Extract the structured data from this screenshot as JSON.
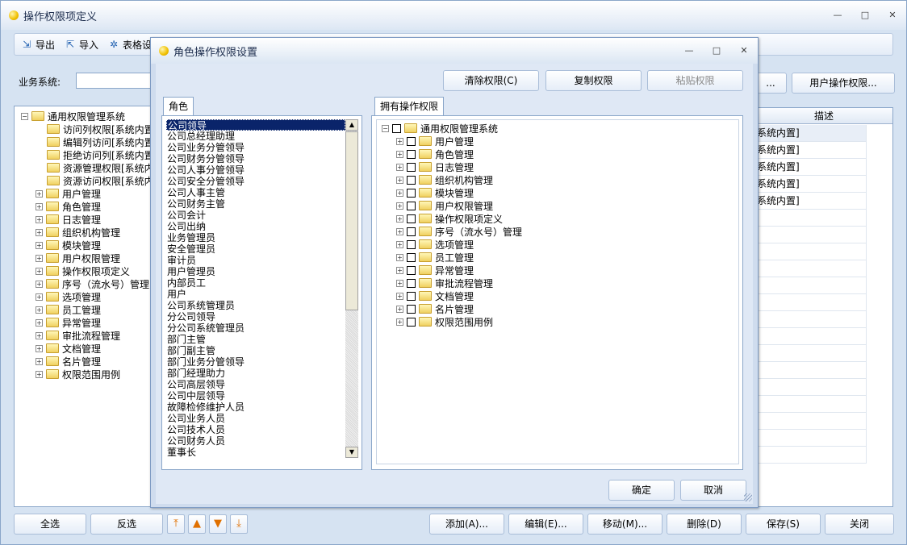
{
  "window": {
    "title": "操作权限项定义",
    "min": "—",
    "max": "□",
    "close": "✕"
  },
  "toolbar": {
    "export": "导出",
    "import": "导入",
    "table_settings": "表格设"
  },
  "business": {
    "label": "业务系统:",
    "value": ""
  },
  "left_tree": {
    "root": "通用权限管理系统",
    "leaves": [
      "访问列权限[系统内置]",
      "编辑列访问[系统内置]",
      "拒绝访问列[系统内置]",
      "资源管理权限[系统内置]",
      "资源访问权限[系统内置]"
    ],
    "nodes": [
      "用户管理",
      "角色管理",
      "日志管理",
      "组织机构管理",
      "模块管理",
      "用户权限管理",
      "操作权限项定义",
      "序号（流水号）管理",
      "选项管理",
      "员工管理",
      "异常管理",
      "审批流程管理",
      "文档管理",
      "名片管理",
      "权限范围用例"
    ]
  },
  "right_grid": {
    "header": "描述",
    "cells": [
      "系统内置]",
      "系统内置]",
      "系统内置]",
      "系统内置]",
      "系统内置]"
    ]
  },
  "main_buttons": {
    "ellipsis": "...",
    "user_perm": "用户操作权限..."
  },
  "bottom": {
    "select_all": "全选",
    "invert": "反选",
    "add": "添加(A)...",
    "edit": "编辑(E)...",
    "move": "移动(M)...",
    "delete": "删除(D)",
    "save": "保存(S)",
    "close": "关闭"
  },
  "arrows": {
    "top": "⤒",
    "up": "▲",
    "down": "▼",
    "bottom": "⤓"
  },
  "dialog": {
    "title": "角色操作权限设置",
    "clear": "清除权限(C)",
    "copy": "复制权限",
    "paste": "粘贴权限",
    "roles_tab": "角色",
    "perm_tab": "拥有操作权限",
    "ok": "确定",
    "cancel": "取消",
    "roles": [
      "公司领导",
      "公司总经理助理",
      "公司业务分管领导",
      "公司财务分管领导",
      "公司人事分管领导",
      "公司安全分管领导",
      "公司人事主管",
      "公司财务主管",
      "公司会计",
      "公司出纳",
      "业务管理员",
      "安全管理员",
      "审计员",
      "用户管理员",
      "内部员工",
      "用户",
      "公司系统管理员",
      "分公司领导",
      "分公司系统管理员",
      "部门主管",
      "部门副主管",
      "部门业务分管领导",
      "部门经理助力",
      "公司高层领导",
      "公司中层领导",
      "故障检修维护人员",
      "公司业务人员",
      "公司技术人员",
      "公司财务人员",
      "董事长"
    ],
    "perm_root": "通用权限管理系统",
    "perm_nodes": [
      "用户管理",
      "角色管理",
      "日志管理",
      "组织机构管理",
      "模块管理",
      "用户权限管理",
      "操作权限项定义",
      "序号（流水号）管理",
      "选项管理",
      "员工管理",
      "异常管理",
      "审批流程管理",
      "文档管理",
      "名片管理",
      "权限范围用例"
    ]
  }
}
